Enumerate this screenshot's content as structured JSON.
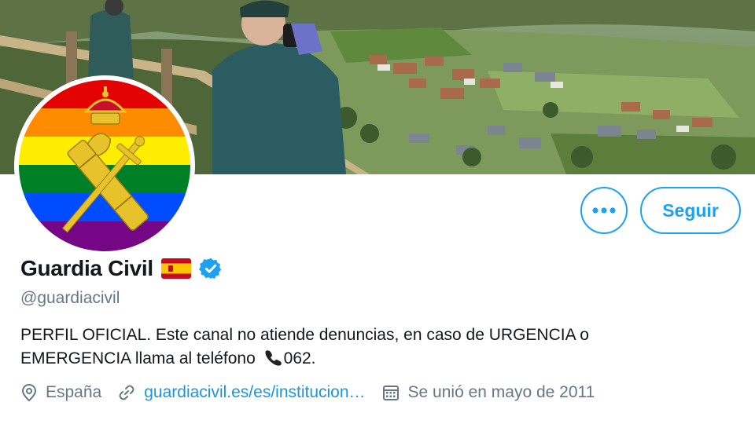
{
  "profile": {
    "name": "Guardia Civil",
    "handle": "@guardiacivil",
    "bio_line1": "PERFIL OFICIAL. Este canal  no atiende denuncias, en caso de URGENCIA o",
    "bio_line2": "EMERGENCIA llama al teléfono",
    "bio_phone": "062.",
    "location": "España",
    "website": "guardiacivil.es/es/institucion…",
    "joined": "Se unió en mayo de 2011",
    "verified": true,
    "flag_emoji": "spain-flag",
    "phone_emoji": "telephone-receiver"
  },
  "actions": {
    "more_label": "•••",
    "follow_label": "Seguir"
  },
  "icons": {
    "location": "location-pin-icon",
    "link": "link-icon",
    "calendar": "calendar-icon",
    "verified": "verified-badge-icon"
  },
  "colors": {
    "accent": "#1da1f2",
    "link": "#1b95e0",
    "secondary_text": "#657786",
    "primary_text": "#14171a",
    "verified": "#1da1f2",
    "emblem_gold": "#e8c22a",
    "rainbow": [
      "#e40303",
      "#ff8c00",
      "#ffed00",
      "#008026",
      "#004dff",
      "#750787"
    ]
  }
}
